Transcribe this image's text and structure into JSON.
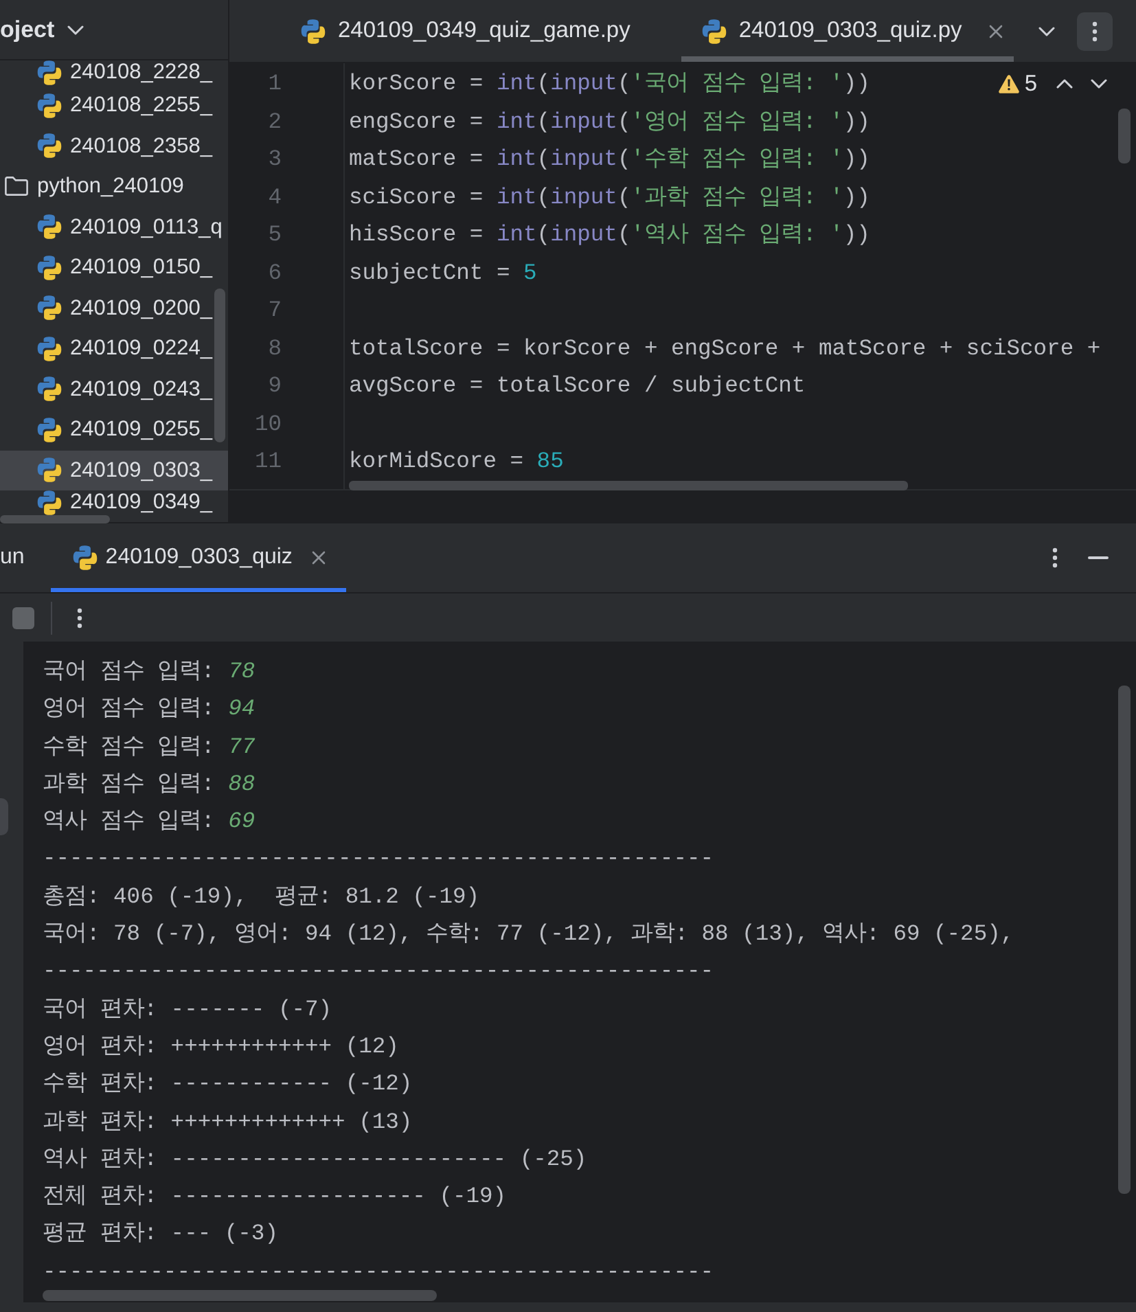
{
  "project_panel": {
    "title": "oject",
    "tree": [
      {
        "kind": "scrolled_group",
        "children": [
          {
            "kind": "file",
            "label": "240108_2228_",
            "selected": false
          },
          {
            "kind": "file",
            "label": "240108_2255_",
            "selected": false
          },
          {
            "kind": "file",
            "label": "240108_2358_",
            "selected": false
          }
        ]
      },
      {
        "kind": "folder",
        "label": "python_240109",
        "selected": false,
        "children": [
          {
            "kind": "file",
            "label": "240109_0113_q",
            "selected": false
          },
          {
            "kind": "file",
            "label": "240109_0150_",
            "selected": false
          },
          {
            "kind": "file",
            "label": "240109_0200_",
            "selected": false
          },
          {
            "kind": "file",
            "label": "240109_0224_",
            "selected": false
          },
          {
            "kind": "file",
            "label": "240109_0243_",
            "selected": false
          },
          {
            "kind": "file",
            "label": "240109_0255_",
            "selected": false
          },
          {
            "kind": "file",
            "label": "240109_0303_",
            "selected": true
          },
          {
            "kind": "file",
            "label": "240109_0349_",
            "selected": false
          }
        ]
      }
    ]
  },
  "editor": {
    "tabs": [
      {
        "label": "240109_0349_quiz_game.py",
        "selected": false
      },
      {
        "label": "240109_0303_quiz.py",
        "selected": true
      }
    ],
    "warning_count": "5",
    "lines": [
      {
        "number": "1",
        "tokens": [
          {
            "kind": "plain",
            "text": "korScore = "
          },
          {
            "kind": "builtin",
            "text": "int"
          },
          {
            "kind": "plain",
            "text": "("
          },
          {
            "kind": "builtin",
            "text": "input"
          },
          {
            "kind": "plain",
            "text": "("
          },
          {
            "kind": "string",
            "text": "'국어 점수 입력: '"
          },
          {
            "kind": "plain",
            "text": "))"
          }
        ]
      },
      {
        "number": "2",
        "tokens": [
          {
            "kind": "plain",
            "text": "engScore = "
          },
          {
            "kind": "builtin",
            "text": "int"
          },
          {
            "kind": "plain",
            "text": "("
          },
          {
            "kind": "builtin",
            "text": "input"
          },
          {
            "kind": "plain",
            "text": "("
          },
          {
            "kind": "string",
            "text": "'영어 점수 입력: '"
          },
          {
            "kind": "plain",
            "text": "))"
          }
        ]
      },
      {
        "number": "3",
        "tokens": [
          {
            "kind": "plain",
            "text": "matScore = "
          },
          {
            "kind": "builtin",
            "text": "int"
          },
          {
            "kind": "plain",
            "text": "("
          },
          {
            "kind": "builtin",
            "text": "input"
          },
          {
            "kind": "plain",
            "text": "("
          },
          {
            "kind": "string",
            "text": "'수학 점수 입력: '"
          },
          {
            "kind": "plain",
            "text": "))"
          }
        ]
      },
      {
        "number": "4",
        "tokens": [
          {
            "kind": "plain",
            "text": "sciScore = "
          },
          {
            "kind": "builtin",
            "text": "int"
          },
          {
            "kind": "plain",
            "text": "("
          },
          {
            "kind": "builtin",
            "text": "input"
          },
          {
            "kind": "plain",
            "text": "("
          },
          {
            "kind": "string",
            "text": "'과학 점수 입력: '"
          },
          {
            "kind": "plain",
            "text": "))"
          }
        ]
      },
      {
        "number": "5",
        "tokens": [
          {
            "kind": "plain",
            "text": "hisScore = "
          },
          {
            "kind": "builtin",
            "text": "int"
          },
          {
            "kind": "plain",
            "text": "("
          },
          {
            "kind": "builtin",
            "text": "input"
          },
          {
            "kind": "plain",
            "text": "("
          },
          {
            "kind": "string",
            "text": "'역사 점수 입력: '"
          },
          {
            "kind": "plain",
            "text": "))"
          }
        ]
      },
      {
        "number": "6",
        "tokens": [
          {
            "kind": "plain",
            "text": "subjectCnt = "
          },
          {
            "kind": "number",
            "text": "5"
          }
        ]
      },
      {
        "number": "7"
      },
      {
        "number": "8",
        "tokens": [
          {
            "kind": "plain",
            "text": "totalScore = korScore + engScore + matScore + sciScore +"
          }
        ]
      },
      {
        "number": "9",
        "tokens": [
          {
            "kind": "plain",
            "text": "avgScore = totalScore / subjectCnt"
          }
        ]
      },
      {
        "number": "10"
      },
      {
        "number": "11",
        "tokens": [
          {
            "kind": "plain",
            "text": "korMidScore = "
          },
          {
            "kind": "number",
            "text": "85"
          }
        ]
      }
    ]
  },
  "run_panel": {
    "title": "un",
    "tabs": [
      {
        "label": "240109_0303_quiz",
        "selected": true
      }
    ],
    "toolbar": [
      {
        "kind": "stop",
        "disabled": true
      },
      {
        "kind": "more"
      }
    ],
    "console": [
      {
        "kind": "prompt",
        "text": "국어 점수 입력: ",
        "input": "78"
      },
      {
        "kind": "prompt",
        "text": "영어 점수 입력: ",
        "input": "94"
      },
      {
        "kind": "prompt",
        "text": "수학 점수 입력: ",
        "input": "77"
      },
      {
        "kind": "prompt",
        "text": "과학 점수 입력: ",
        "input": "88"
      },
      {
        "kind": "prompt",
        "text": "역사 점수 입력: ",
        "input": "69"
      },
      {
        "kind": "output",
        "text": "--------------------------------------------------"
      },
      {
        "kind": "output",
        "text": "총점: 406 (-19),  평균: 81.2 (-19)"
      },
      {
        "kind": "output",
        "text": "국어: 78 (-7), 영어: 94 (12), 수학: 77 (-12), 과학: 88 (13), 역사: 69 (-25),"
      },
      {
        "kind": "output",
        "text": "--------------------------------------------------"
      },
      {
        "kind": "output",
        "text": "국어 편차: ------- (-7)"
      },
      {
        "kind": "output",
        "text": "영어 편차: ++++++++++++ (12)"
      },
      {
        "kind": "output",
        "text": "수학 편차: ------------ (-12)"
      },
      {
        "kind": "output",
        "text": "과학 편차: +++++++++++++ (13)"
      },
      {
        "kind": "output",
        "text": "역사 편차: ------------------------- (-25)"
      },
      {
        "kind": "output",
        "text": "전체 편차: ------------------- (-19)"
      },
      {
        "kind": "output",
        "text": "평균 편차: --- (-3)"
      },
      {
        "kind": "output",
        "text": "--------------------------------------------------"
      }
    ]
  }
}
